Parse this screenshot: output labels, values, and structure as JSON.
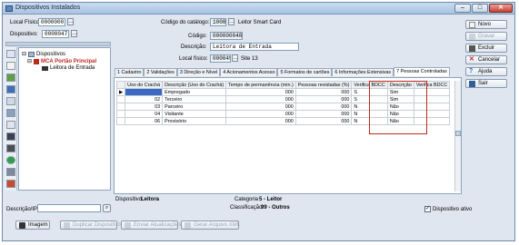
{
  "window": {
    "title": "Dispositivos Instalados",
    "controls": {
      "minimize": "–",
      "maximize": "□",
      "close": "✕"
    }
  },
  "filters": {
    "local_fisico_label": "Local Físico:",
    "local_fisico_value": "0000000",
    "dispositivo_label": "Dispositivo:",
    "dispositivo_value": "0000047"
  },
  "catalog": {
    "codigo_catalogo_label": "Código do catálogo:",
    "codigo_catalogo_value": "1008",
    "catalogo_nome": "Leitor Smart Card"
  },
  "form": {
    "codigo_label": "Código:",
    "codigo_value": "000000048",
    "descricao_label": "Descrição:",
    "descricao_value": "Leitora de Entrada",
    "local_fisico_label": "Local físico:",
    "local_fisico_value": "000049",
    "local_fisico_nome": "Site 13"
  },
  "tree": {
    "root": "Dispositivos",
    "node": "MCA Portão Principal",
    "leaf": "Leitora de Entrada"
  },
  "tabs": [
    "1 Cadastro",
    "2 Validações",
    "3 Direção e Nível",
    "4 Acionamentos Acesso",
    "5 Formatos de cartões",
    "6 Informações Extensivas",
    "7 Pessoas Controladas"
  ],
  "grid": {
    "columns": [
      "Uso do Crachá",
      "Descrição (Uso do Crachá)",
      "Tempo de permanência (min.)",
      "Pessoas revistadas (%)",
      "Verifica BDCC",
      "Descrição",
      "Verifica BDCC"
    ],
    "rows": [
      {
        "uso": "",
        "descricao": "Empregado",
        "tempo": "000",
        "pessoas": "000",
        "verifica": "S",
        "desc2": "Sim"
      },
      {
        "uso": "02",
        "descricao": "Terceiro",
        "tempo": "000",
        "pessoas": "000",
        "verifica": "S",
        "desc2": "Sim"
      },
      {
        "uso": "03",
        "descricao": "Parceiro",
        "tempo": "000",
        "pessoas": "000",
        "verifica": "N",
        "desc2": "Não"
      },
      {
        "uso": "04",
        "descricao": "Visitante",
        "tempo": "000",
        "pessoas": "000",
        "verifica": "N",
        "desc2": "Não"
      },
      {
        "uso": "06",
        "descricao": "Provisório",
        "tempo": "000",
        "pessoas": "000",
        "verifica": "N",
        "desc2": "Não"
      }
    ]
  },
  "sidebar_buttons": [
    "Novo",
    "Gravar",
    "Excluir",
    "Cancelar",
    "Ajuda",
    "Sair"
  ],
  "status": {
    "dispositivo_label": "Dispositivo:",
    "dispositivo_value": "Leitora",
    "categoria_label": "Categoria",
    "categoria_value": "5 - Leitor",
    "classificacao_label": "Classificação:",
    "classificacao_value": "99 - Outros",
    "ativo_label": "Dispositivo ativo"
  },
  "search": {
    "label": "Descrição/IP:"
  },
  "bottom_buttons": [
    "Imagem",
    "Duplicar Dispositivo",
    "Enviar Atualizações",
    "Gerar Arquivo XML"
  ]
}
